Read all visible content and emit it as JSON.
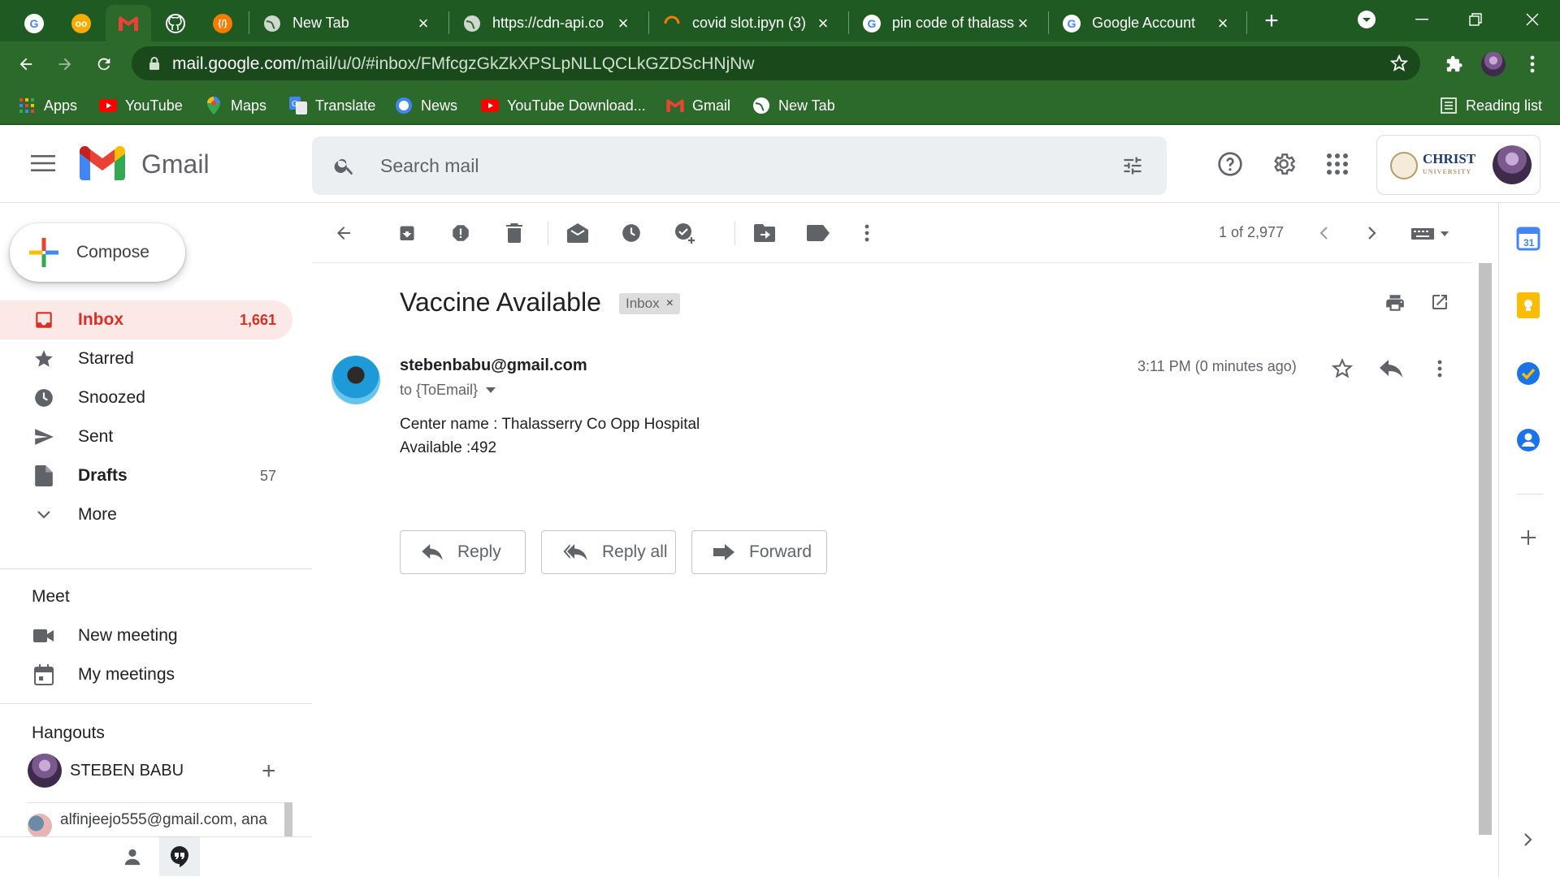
{
  "browser": {
    "tabs": [
      {
        "title": "New Tab"
      },
      {
        "title": "https://cdn-api.co"
      },
      {
        "title": "covid slot.ipyn (3)"
      },
      {
        "title": "pin code of thalass"
      },
      {
        "title": "Google Account"
      }
    ],
    "url_host": "mail.google.com",
    "url_path": "/mail/u/0/#inbox/FMfcgzGkZkXPSLpNLLQCLkGZDScHNjNw",
    "bookmarks": [
      "Apps",
      "YouTube",
      "Maps",
      "Translate",
      "News",
      "YouTube Download...",
      "Gmail",
      "New Tab"
    ],
    "reading_list": "Reading list"
  },
  "gmail": {
    "product_name": "Gmail",
    "search_placeholder": "Search mail",
    "account_org": "CHRIST",
    "account_org_sub": "UNIVERSITY",
    "compose_label": "Compose",
    "nav": [
      {
        "label": "Inbox",
        "count": "1,661"
      },
      {
        "label": "Starred",
        "count": ""
      },
      {
        "label": "Snoozed",
        "count": ""
      },
      {
        "label": "Sent",
        "count": ""
      },
      {
        "label": "Drafts",
        "count": "57"
      },
      {
        "label": "More",
        "count": ""
      }
    ],
    "meet": {
      "title": "Meet",
      "items": [
        "New meeting",
        "My meetings"
      ]
    },
    "hangouts": {
      "title": "Hangouts",
      "user": "STEBEN BABU",
      "contact": "alfinjeejo555@gmail.com, ana"
    },
    "pager": "1 of 2,977",
    "message": {
      "subject": "Vaccine Available",
      "label_chip": "Inbox",
      "sender": "stebenbabu@gmail.com",
      "to": "to {ToEmail}",
      "time": "3:11 PM (0 minutes ago)",
      "body": [
        "Center name : Thalasserry Co Opp Hospital",
        "Available :492"
      ]
    },
    "actions": {
      "reply": "Reply",
      "reply_all": "Reply all",
      "forward": "Forward"
    }
  },
  "colors": {
    "chrome_frame": "#1e5a21",
    "chrome_toolbar": "#2b6a2a",
    "gmail_red": "#d93025",
    "inbox_highlight": "#fce8e6",
    "icon_grey": "#5f6368"
  }
}
